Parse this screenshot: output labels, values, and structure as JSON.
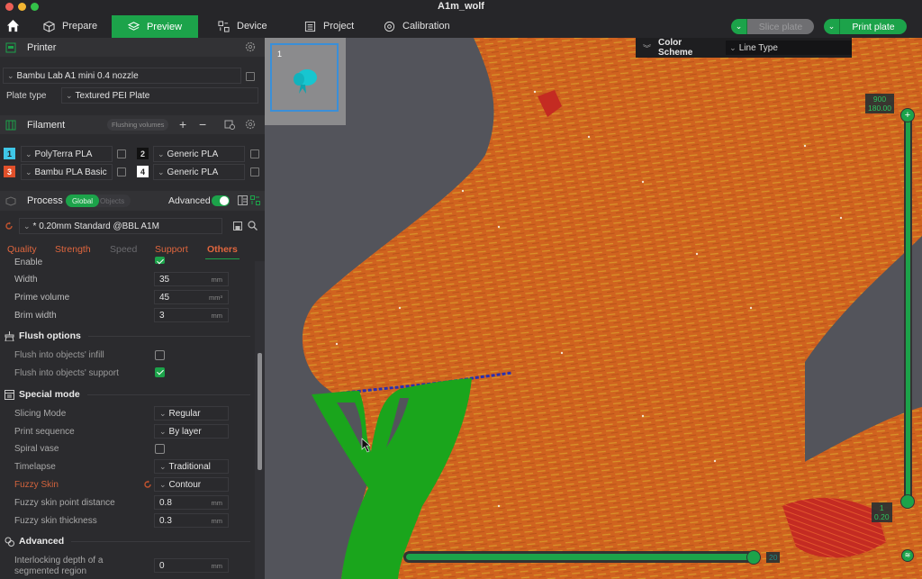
{
  "window": {
    "title": "A1m_wolf"
  },
  "nav": {
    "tabs": [
      {
        "label": "Prepare",
        "icon": "cube-icon"
      },
      {
        "label": "Preview",
        "icon": "layers-icon",
        "active": true
      },
      {
        "label": "Device",
        "icon": "device-icon"
      },
      {
        "label": "Project",
        "icon": "project-icon"
      },
      {
        "label": "Calibration",
        "icon": "calibration-icon"
      }
    ],
    "slice_plate": "Slice plate",
    "print_plate": "Print plate"
  },
  "printer": {
    "header": "Printer",
    "printer_name": "Bambu Lab A1 mini 0.4 nozzle",
    "plate_type_label": "Plate type",
    "plate_type": "Textured PEI Plate"
  },
  "filament": {
    "header": "Filament",
    "flushing_volumes": "Flushing volumes",
    "items": [
      {
        "num": "1",
        "name": "PolyTerra PLA",
        "color": "#3fc7e8"
      },
      {
        "num": "2",
        "name": "Generic PLA",
        "color": "#111111"
      },
      {
        "num": "3",
        "name": "Bambu PLA Basic",
        "color": "#e0502a"
      },
      {
        "num": "4",
        "name": "Generic PLA",
        "color": "#ffffff"
      }
    ]
  },
  "process": {
    "header": "Process",
    "toggle_global": "Global",
    "toggle_objects": "Objects",
    "advanced_label": "Advanced",
    "advanced_on": true,
    "preset": "* 0.20mm Standard @BBL A1M",
    "tabs": [
      {
        "label": "Quality",
        "color": "#e0663e"
      },
      {
        "label": "Strength",
        "color": "#e0663e"
      },
      {
        "label": "Speed",
        "color": "#6a6a6e"
      },
      {
        "label": "Support",
        "color": "#e0663e"
      },
      {
        "label": "Others",
        "color": "#e0663e",
        "active": true
      }
    ]
  },
  "settings": {
    "enable_label": "Enable",
    "enable_checked": true,
    "width": {
      "label": "Width",
      "value": "35",
      "unit": "mm"
    },
    "prime_volume": {
      "label": "Prime volume",
      "value": "45",
      "unit": "mm³"
    },
    "brim_width": {
      "label": "Brim width",
      "value": "3",
      "unit": "mm"
    },
    "flush_options": {
      "title": "Flush options",
      "infill": {
        "label": "Flush into objects' infill",
        "checked": false
      },
      "support": {
        "label": "Flush into objects' support",
        "checked": true
      }
    },
    "special_mode": {
      "title": "Special mode",
      "slicing_mode": {
        "label": "Slicing Mode",
        "value": "Regular"
      },
      "print_sequence": {
        "label": "Print sequence",
        "value": "By layer"
      },
      "spiral_vase": {
        "label": "Spiral vase",
        "checked": false
      },
      "timelapse": {
        "label": "Timelapse",
        "value": "Traditional"
      },
      "fuzzy_skin": {
        "label": "Fuzzy Skin",
        "value": "Contour"
      },
      "fuzzy_point_distance": {
        "label": "Fuzzy skin point distance",
        "value": "0.8",
        "unit": "mm"
      },
      "fuzzy_thickness": {
        "label": "Fuzzy skin thickness",
        "value": "0.3",
        "unit": "mm"
      }
    },
    "advanced": {
      "title": "Advanced",
      "interlocking_line1": "Interlocking depth of a",
      "interlocking_line2": "segmented region",
      "interlocking_value": "0",
      "interlocking_unit": "mm"
    }
  },
  "viewport": {
    "plate_number": "1",
    "color_scheme_label": "Color Scheme",
    "color_scheme_value": "Line Type",
    "layer_top": {
      "layer": "900",
      "height": "180.00"
    },
    "layer_bottom": {
      "layer": "1",
      "height": "0.20"
    },
    "move_value": "20",
    "layer_slider_fraction": 1.0,
    "move_slider_fraction": 1.0
  }
}
